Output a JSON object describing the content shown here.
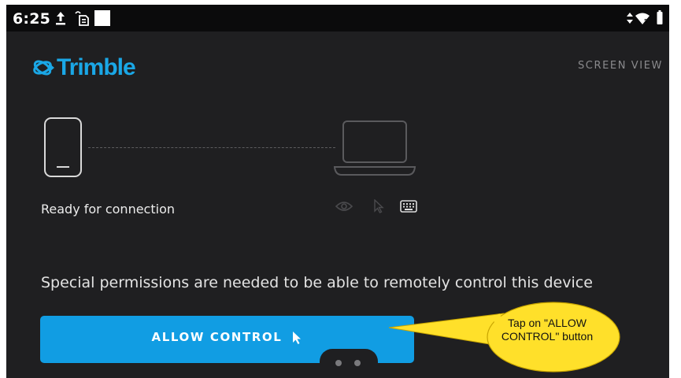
{
  "status_bar": {
    "time": "6:25",
    "left_icons": [
      "upload-icon",
      "sim-notification-icon",
      "white-square-icon"
    ],
    "right_icons": [
      "data-arrows-icon",
      "wifi-icon",
      "battery-icon"
    ]
  },
  "header": {
    "logo_text": "Trimble",
    "mode_label": "SCREEN VIEW"
  },
  "connection": {
    "status_label": "Ready for connection",
    "permission_icons": [
      "eye-icon",
      "pointer-icon",
      "keyboard-icon"
    ]
  },
  "main": {
    "message": "Special permissions are needed to be able to remotely control this device",
    "allow_button_label": "ALLOW CONTROL"
  },
  "annotation": {
    "text": "Tap on \"ALLOW CONTROL\" button"
  },
  "colors": {
    "background": "#1f1f21",
    "accent": "#119de3",
    "logo": "#1aa7e6",
    "callout": "#ffe02a"
  }
}
